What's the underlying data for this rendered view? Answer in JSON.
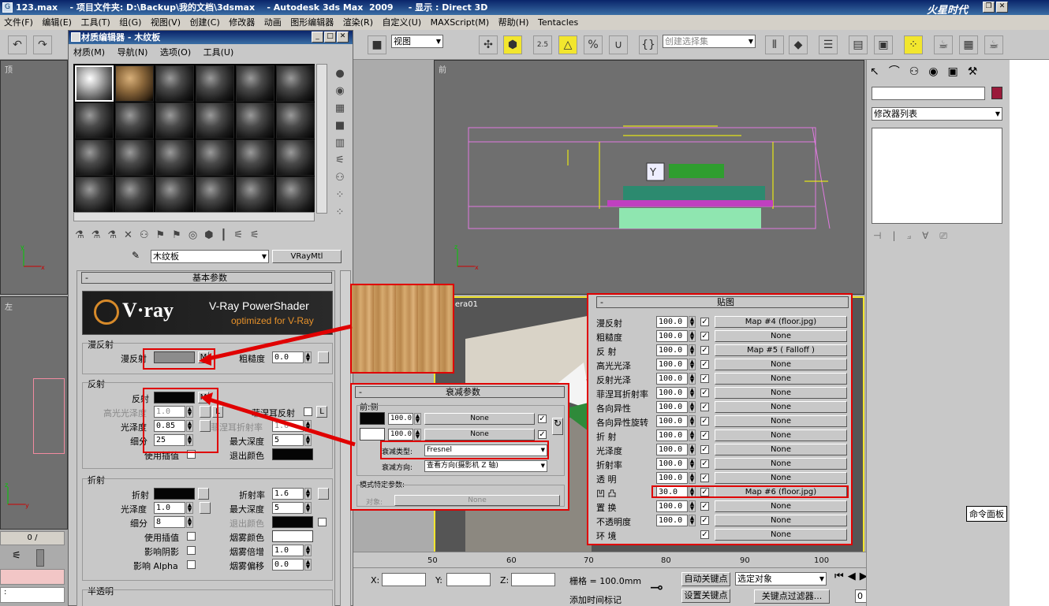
{
  "window": {
    "title": "123.max    - 项目文件夹: D:\\Backup\\我的文档\\3dsmax    - Autodesk 3ds Max  2009     - 显示 : Direct 3D",
    "watermark": "火星时代"
  },
  "menubar": {
    "items": [
      "文件(F)",
      "编辑(E)",
      "工具(T)",
      "组(G)",
      "视图(V)",
      "创建(C)",
      "修改器",
      "动画",
      "图形编辑器",
      "渲染(R)",
      "自定义(U)",
      "MAXScript(M)",
      "帮助(H)",
      "Tentacles"
    ]
  },
  "toolbar": {
    "view_select": "视图",
    "selection_set": "创建选择集",
    "snap_value": "2.5"
  },
  "viewports": {
    "top": "顶",
    "left": "左",
    "front": "前",
    "camera": "Camera01"
  },
  "material_editor": {
    "title": "材质编辑器 - 木纹板",
    "menu": [
      "材质(M)",
      "导航(N)",
      "选项(O)",
      "工具(U)"
    ],
    "material_name": "木纹板",
    "material_type": "VRayMtl",
    "basic_params_title": "基本参数",
    "vray_logo": "V·ray",
    "vray_line1": "V-Ray PowerShader",
    "vray_line2": "optimized for V-Ray",
    "diffuse_group": "漫反射",
    "diffuse_label": "漫反射",
    "diffuse_map": "M",
    "roughness_label": "粗糙度",
    "roughness_value": "0.0",
    "reflection_group": "反射",
    "reflect_label": "反射",
    "reflect_map": "M",
    "hilight_gloss_label": "高光光泽度",
    "hilight_gloss_value": "1.0",
    "hilight_lock": "L",
    "fresnel_label": "菲涅耳反射",
    "fresnel_lock": "L",
    "refl_gloss_label": "光泽度",
    "refl_gloss_value": "0.85",
    "fresnel_ior_label": "菲涅耳折射率",
    "fresnel_ior_value": "1.6",
    "subdivs_label": "细分",
    "subdivs_value": "25",
    "max_depth_label": "最大深度",
    "max_depth_value": "5",
    "use_interp_label": "使用插值",
    "exit_color_label": "退出颜色",
    "refraction_group": "折射",
    "refract_label": "折射",
    "ior_label": "折射率",
    "ior_value": "1.6",
    "refr_gloss_label": "光泽度",
    "refr_gloss_value": "1.0",
    "refr_max_depth_label": "最大深度",
    "refr_max_depth_value": "5",
    "refr_subdivs_label": "细分",
    "refr_subdivs_value": "8",
    "refr_exit_label": "退出颜色",
    "refr_interp_label": "使用插值",
    "fog_color_label": "烟雾颜色",
    "affect_shadows_label": "影响阴影",
    "fog_mult_label": "烟雾倍增",
    "fog_mult_value": "1.0",
    "affect_alpha_label": "影响 Alpha",
    "fog_bias_label": "烟雾偏移",
    "fog_bias_value": "0.0",
    "translucency_group": "半透明"
  },
  "falloff": {
    "title": "衰减参数",
    "group": "前:侧",
    "row1_value": "100.0",
    "row1_map": "None",
    "row2_value": "100.0",
    "row2_map": "None",
    "type_label": "衰减类型:",
    "type_value": "Fresnel",
    "dir_label": "衰减方向:",
    "dir_value": "查看方向(摄影机 Z 轴)",
    "mode_title": "模式特定参数:",
    "object_label": "对象:",
    "object_value": "None"
  },
  "maps": {
    "title": "贴图",
    "rows": [
      {
        "name": "漫反射",
        "value": "100.0",
        "map": "Map #4  (floor.jpg)"
      },
      {
        "name": "粗糙度",
        "value": "100.0",
        "map": "None"
      },
      {
        "name": "反  射",
        "value": "100.0",
        "map": "Map #5  ( Falloff )"
      },
      {
        "name": "高光光泽",
        "value": "100.0",
        "map": "None"
      },
      {
        "name": "反射光泽",
        "value": "100.0",
        "map": "None"
      },
      {
        "name": "菲涅耳折射率",
        "value": "100.0",
        "map": "None"
      },
      {
        "name": "各向异性",
        "value": "100.0",
        "map": "None"
      },
      {
        "name": "各向异性旋转",
        "value": "100.0",
        "map": "None"
      },
      {
        "name": "折  射",
        "value": "100.0",
        "map": "None"
      },
      {
        "name": "光泽度",
        "value": "100.0",
        "map": "None"
      },
      {
        "name": "折射率",
        "value": "100.0",
        "map": "None"
      },
      {
        "name": "透  明",
        "value": "100.0",
        "map": "None"
      },
      {
        "name": "凹  凸",
        "value": "30.0",
        "map": "Map #6  (floor.jpg)"
      },
      {
        "name": "置  换",
        "value": "100.0",
        "map": "None"
      },
      {
        "name": "不透明度",
        "value": "100.0",
        "map": "None"
      },
      {
        "name": "环  境",
        "value": "",
        "map": "None"
      }
    ]
  },
  "command_panel": {
    "modifier_list": "修改器列表",
    "tooltip": "命令面板"
  },
  "timeline": {
    "frame": "0 / ",
    "ticks": [
      "50",
      "60",
      "70",
      "80",
      "90",
      "100"
    ]
  },
  "status": {
    "x_label": "X:",
    "y_label": "Y:",
    "z_label": "Z:",
    "grid": "栅格 = 100.0mm",
    "add_time_tag": "添加时间标记",
    "auto_key": "自动关键点",
    "set_key": "设置关键点",
    "selected_object": "选定对象",
    "key_filters": "关键点过滤器...",
    "frame_field": "0"
  },
  "colors": {
    "accent_red": "#e00000",
    "title_blue": "#0a246a",
    "viewport_gray": "#6f6f6f",
    "selected_yellow": "#f2e62e"
  }
}
